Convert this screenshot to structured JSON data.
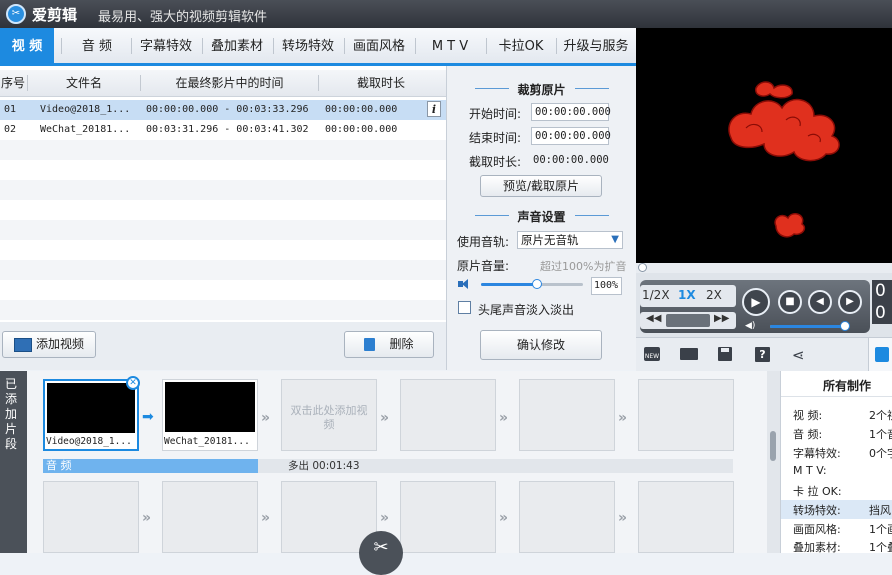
{
  "app": {
    "name": "爱剪辑",
    "slogan": "最易用、强大的视频剪辑软件",
    "logo_icon": "scissors-logo-icon"
  },
  "tabs": [
    "视 频",
    "音 频",
    "字幕特效",
    "叠加素材",
    "转场特效",
    "画面风格",
    "M T V",
    "卡拉OK",
    "升级与服务"
  ],
  "clip_table": {
    "headers": [
      "序号",
      "文件名",
      "在最终影片中的时间",
      "截取时长"
    ],
    "rows": [
      {
        "index": "01",
        "file": "Video@2018_1...",
        "time_range": "00:00:00.000 - 00:03:33.296",
        "duration": "00:00:00.000"
      },
      {
        "index": "02",
        "file": "WeChat_20181...",
        "time_range": "00:03:31.296 - 00:03:41.302",
        "duration": "00:00:00.000"
      }
    ]
  },
  "buttons": {
    "add_video": "添加视频",
    "delete": "删除",
    "preview_cut": "预览/截取原片",
    "confirm": "确认修改"
  },
  "trim": {
    "title": "裁剪原片",
    "start_label": "开始时间:",
    "start_value": "00:00:00.000",
    "end_label": "结束时间:",
    "end_value": "00:00:00.000",
    "dur_label": "截取时长:",
    "dur_value": "00:00:00.000"
  },
  "sound": {
    "title": "声音设置",
    "track_label": "使用音轨:",
    "track_value": "原片无音轨",
    "volume_label": "原片音量:",
    "volume_hint": "超过100%为扩音",
    "volume_value": "100%",
    "volume_level": 0.55,
    "fade_label": "头尾声音淡入淡出"
  },
  "player": {
    "speeds": [
      "1/2X",
      "1X",
      "2X"
    ],
    "active_speed": "1X",
    "time_partial": "0",
    "accent": "#1d8ae0"
  },
  "timeline": {
    "side_label": "已添加片段",
    "clips": [
      "Video@2018_1...",
      "WeChat_20181..."
    ],
    "placeholder": "双击此处添加视频",
    "audio_label": "音 频",
    "audio_extra": "多出 00:01:43"
  },
  "info_panel": {
    "title": "所有制作",
    "rows": [
      {
        "label": "视   频:",
        "value": "2个视"
      },
      {
        "label": "音   频:",
        "value": "1个音"
      },
      {
        "label": "字幕特效:",
        "value": "0个字"
      },
      {
        "label": "M  T  V:",
        "value": ""
      },
      {
        "label": "卡 拉 OK:",
        "value": ""
      },
      {
        "label": "转场特效:",
        "value": "挡风"
      },
      {
        "label": "画面风格:",
        "value": "1个画"
      },
      {
        "label": "叠加素材:",
        "value": "1个叠"
      }
    ]
  }
}
